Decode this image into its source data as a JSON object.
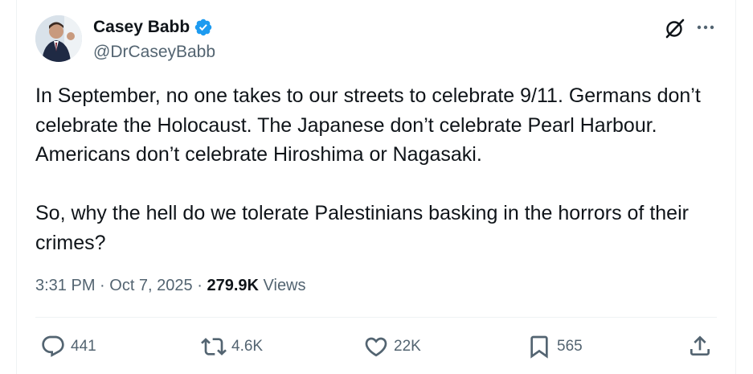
{
  "author": {
    "display_name": "Casey Babb",
    "handle": "@DrCaseyBabb",
    "verified": true,
    "verified_color": "#1d9bf0"
  },
  "tweet": {
    "text": "In September, no one takes to our streets to celebrate 9/11. Germans don’t celebrate the Holocaust. The Japanese don’t celebrate Pearl Harbour. Americans don’t celebrate Hiroshima or Nagasaki.\n\nSo, why the hell do we tolerate Palestinians basking in the horrors of their crimes?",
    "time": "3:31 PM",
    "date": "Oct 7, 2025",
    "separator": " · ",
    "views_count": "279.9K",
    "views_label": "Views"
  },
  "actions": {
    "replies": "441",
    "reposts": "4.6K",
    "likes": "22K",
    "bookmarks": "565"
  },
  "icons": {
    "header": [
      "grok-icon",
      "more-icon"
    ],
    "action_bar": [
      "reply-icon",
      "repost-icon",
      "like-icon",
      "bookmark-icon",
      "share-icon"
    ]
  },
  "colors": {
    "text_primary": "#0f1419",
    "text_secondary": "#536471",
    "divider": "#eff3f4"
  }
}
